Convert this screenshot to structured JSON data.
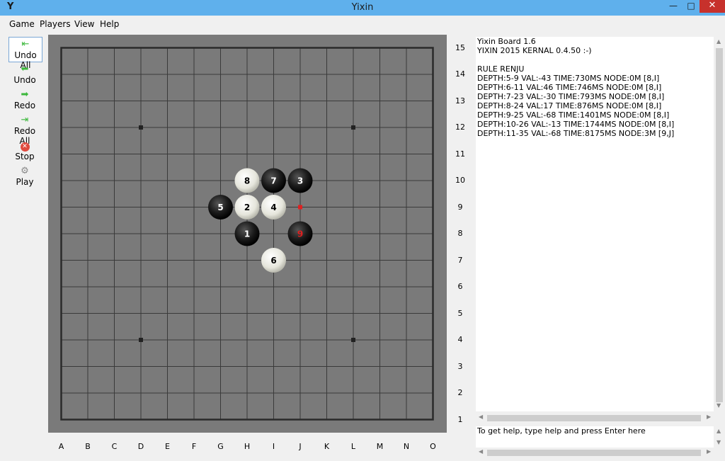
{
  "window": {
    "title": "Yixin",
    "app_icon": "Y",
    "minimize": "—",
    "maximize": "□",
    "close": "✕"
  },
  "menu": [
    "Game",
    "Players",
    "View",
    "Help"
  ],
  "toolbar": [
    {
      "label": "Undo All",
      "icon": "undo-all-icon",
      "glyph": "⇤"
    },
    {
      "label": "Undo",
      "icon": "undo-icon",
      "glyph": "⬅"
    },
    {
      "label": "Redo",
      "icon": "redo-icon",
      "glyph": "➡"
    },
    {
      "label": "Redo All",
      "icon": "redo-all-icon",
      "glyph": "⇥"
    },
    {
      "label": "Stop",
      "icon": "stop-icon",
      "glyph": "✕"
    },
    {
      "label": "Play",
      "icon": "play-icon",
      "glyph": "⚙"
    }
  ],
  "board": {
    "columns": [
      "A",
      "B",
      "C",
      "D",
      "E",
      "F",
      "G",
      "H",
      "I",
      "J",
      "K",
      "L",
      "M",
      "N",
      "O"
    ],
    "rows": [
      "15",
      "14",
      "13",
      "12",
      "11",
      "10",
      "9",
      "8",
      "7",
      "6",
      "5",
      "4",
      "3",
      "2",
      "1"
    ],
    "background": "#7a7a7a",
    "line_color": "#3a3a3a",
    "star_points": [
      "D12",
      "L12",
      "D4",
      "L4"
    ],
    "last_move_marker": "J9",
    "last_move_color": "#e02020",
    "stones": [
      {
        "num": "1",
        "color": "black",
        "pos": "H8"
      },
      {
        "num": "2",
        "color": "white",
        "pos": "H9"
      },
      {
        "num": "3",
        "color": "black",
        "pos": "J10"
      },
      {
        "num": "4",
        "color": "white",
        "pos": "I9"
      },
      {
        "num": "5",
        "color": "black",
        "pos": "G9"
      },
      {
        "num": "6",
        "color": "white",
        "pos": "I7"
      },
      {
        "num": "7",
        "color": "black",
        "pos": "I10"
      },
      {
        "num": "8",
        "color": "white",
        "pos": "H10"
      },
      {
        "num": "9",
        "color": "black",
        "pos": "J8",
        "last": true
      }
    ]
  },
  "log": [
    "Yixin Board 1.6",
    "YIXIN 2015 KERNAL 0.4.50 :-)",
    "",
    "RULE RENJU",
    "DEPTH:5-9 VAL:-43 TIME:730MS NODE:0M [8,I]",
    "DEPTH:6-11 VAL:46 TIME:746MS NODE:0M [8,I]",
    "DEPTH:7-23 VAL:-30 TIME:793MS NODE:0M [8,I]",
    "DEPTH:8-24 VAL:17 TIME:876MS NODE:0M [8,I]",
    "DEPTH:9-25 VAL:-68 TIME:1401MS NODE:0M [8,I]",
    "DEPTH:10-26 VAL:-13 TIME:1744MS NODE:0M [8,I]",
    "DEPTH:11-35 VAL:-68 TIME:8175MS NODE:3M [9,J]"
  ],
  "command_input": {
    "value": "To get help, type help and press Enter here"
  }
}
